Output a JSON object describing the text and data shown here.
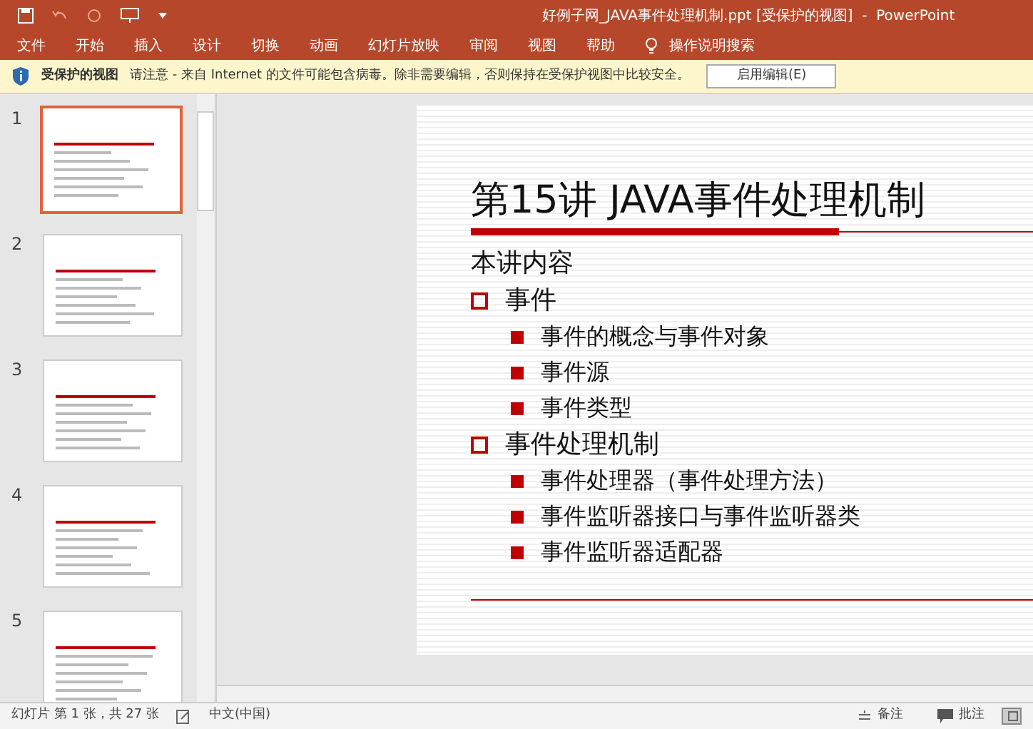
{
  "window": {
    "title": "好例子网_JAVA事件处理机制.ppt [受保护的视图]  -  PowerPoint"
  },
  "ribbon_tabs": [
    {
      "label": "文件"
    },
    {
      "label": "开始"
    },
    {
      "label": "插入"
    },
    {
      "label": "设计"
    },
    {
      "label": "切换"
    },
    {
      "label": "动画"
    },
    {
      "label": "幻灯片放映"
    },
    {
      "label": "审阅"
    },
    {
      "label": "视图"
    },
    {
      "label": "帮助"
    }
  ],
  "tell_me": "操作说明搜索",
  "protected_bar": {
    "title": "受保护的视图",
    "message": "请注意 - 来自 Internet 的文件可能包含病毒。除非需要编辑，否则保持在受保护视图中比较安全。",
    "button": "启用编辑(E)"
  },
  "thumbnails": [
    {
      "number": "1",
      "selected": true
    },
    {
      "number": "2",
      "selected": false
    },
    {
      "number": "3",
      "selected": false
    },
    {
      "number": "4",
      "selected": false
    },
    {
      "number": "5",
      "selected": false
    }
  ],
  "slide": {
    "title": "第15讲 JAVA事件处理机制",
    "subtitle": "本讲内容",
    "items": [
      {
        "text": "事件",
        "children": [
          {
            "text": "事件的概念与事件对象"
          },
          {
            "text": "事件源"
          },
          {
            "text": "事件类型"
          }
        ]
      },
      {
        "text": "事件处理机制",
        "children": [
          {
            "text": "事件处理器（事件处理方法）"
          },
          {
            "text": "事件监听器接口与事件监听器类"
          },
          {
            "text": "事件监听器适配器"
          }
        ]
      }
    ]
  },
  "status_bar": {
    "slide_info": "幻灯片 第 1 张，共 27 张",
    "language": "中文(中国)",
    "notes": "备注",
    "comments": "批注"
  }
}
